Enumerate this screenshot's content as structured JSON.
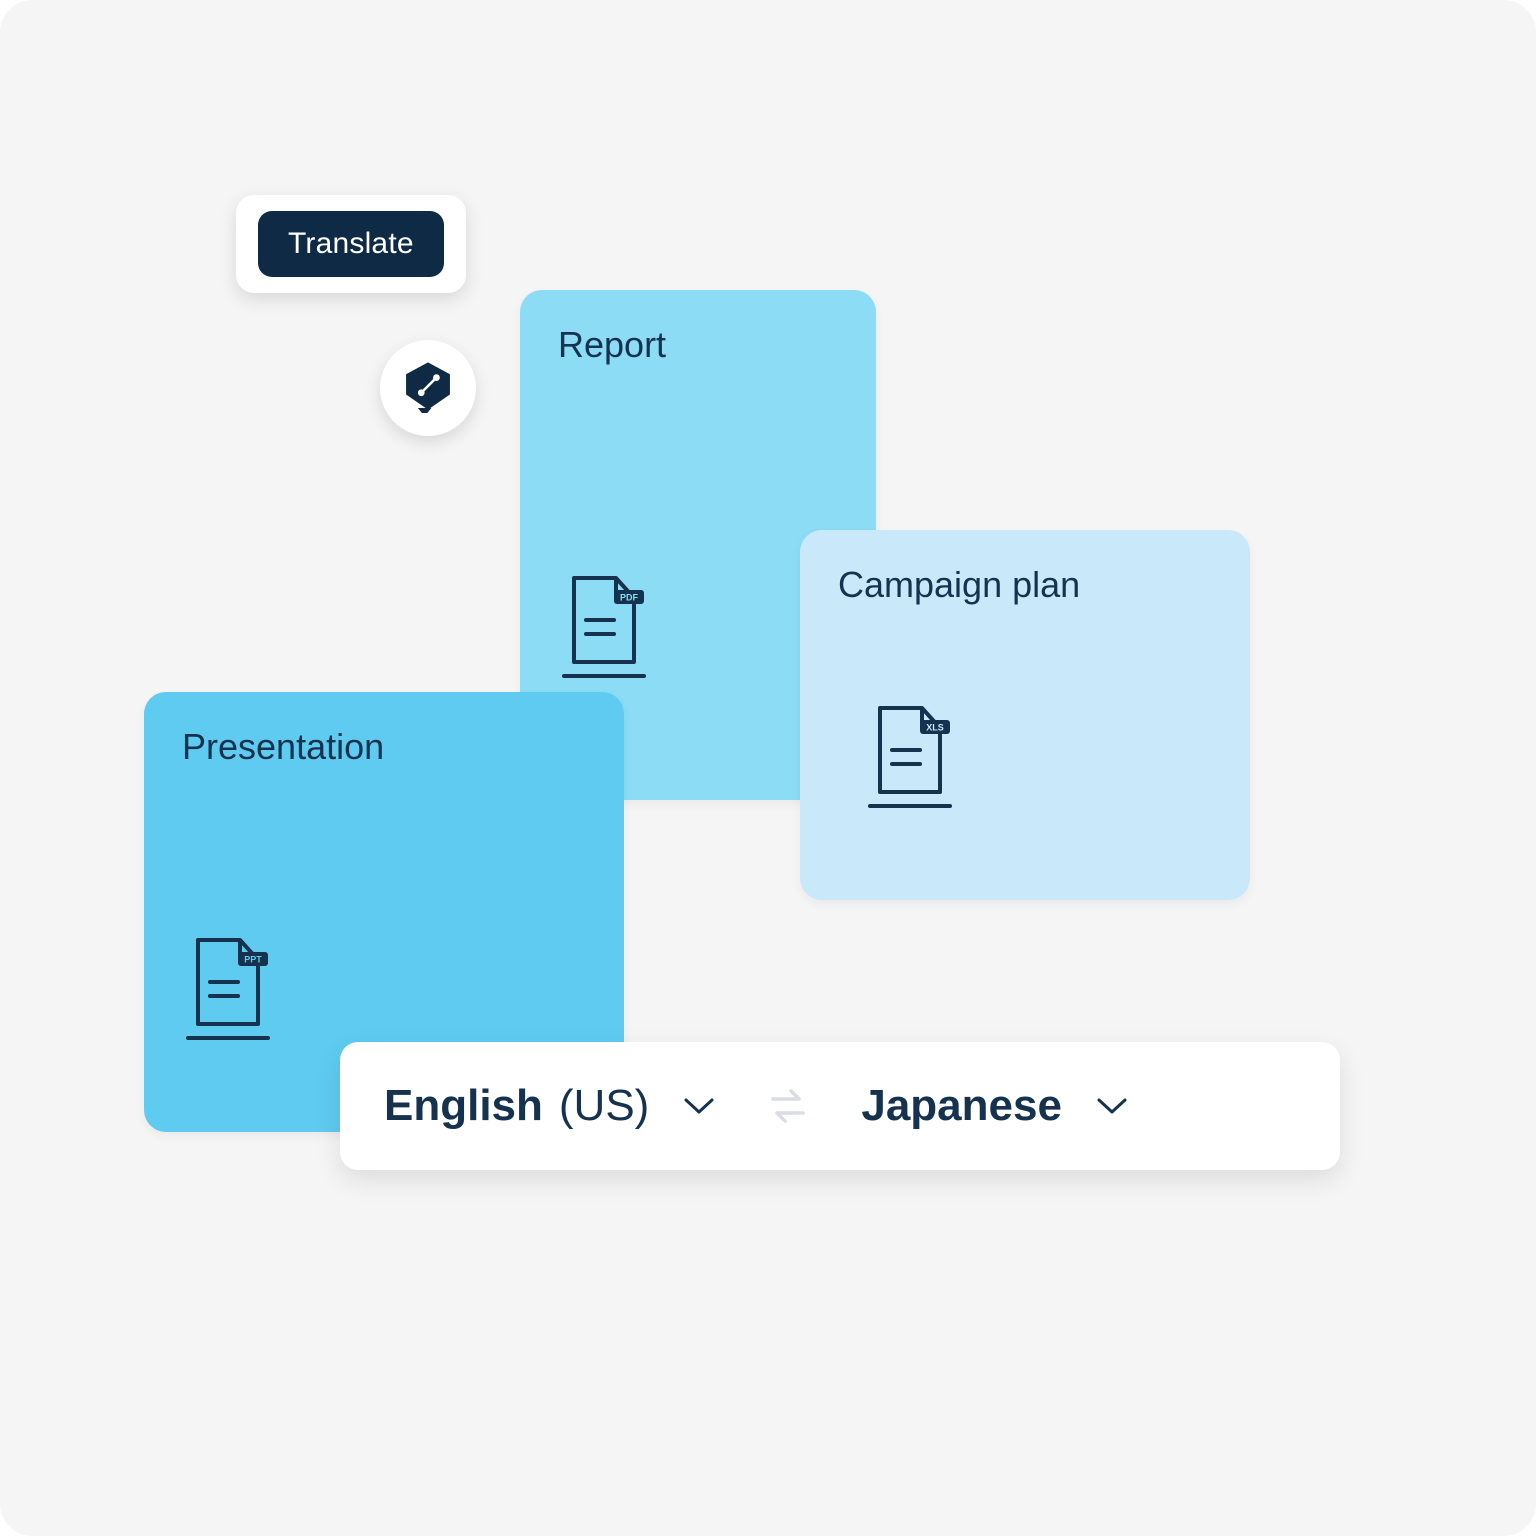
{
  "action": {
    "translate_label": "Translate"
  },
  "cards": {
    "report": {
      "title": "Report",
      "file_type": "PDF"
    },
    "campaign": {
      "title": "Campaign plan",
      "file_type": "XLS"
    },
    "presentation": {
      "title": "Presentation",
      "file_type": "PPT"
    }
  },
  "languages": {
    "source": {
      "name": "English",
      "variant": "(US)"
    },
    "target": {
      "name": "Japanese"
    }
  },
  "colors": {
    "background": "#f5f5f5",
    "dark": "#0f2a44",
    "text": "#15324e",
    "card_report": "#8bdcf4",
    "card_campaign": "#c9e9fb",
    "card_presentation": "#5fcbf0"
  }
}
